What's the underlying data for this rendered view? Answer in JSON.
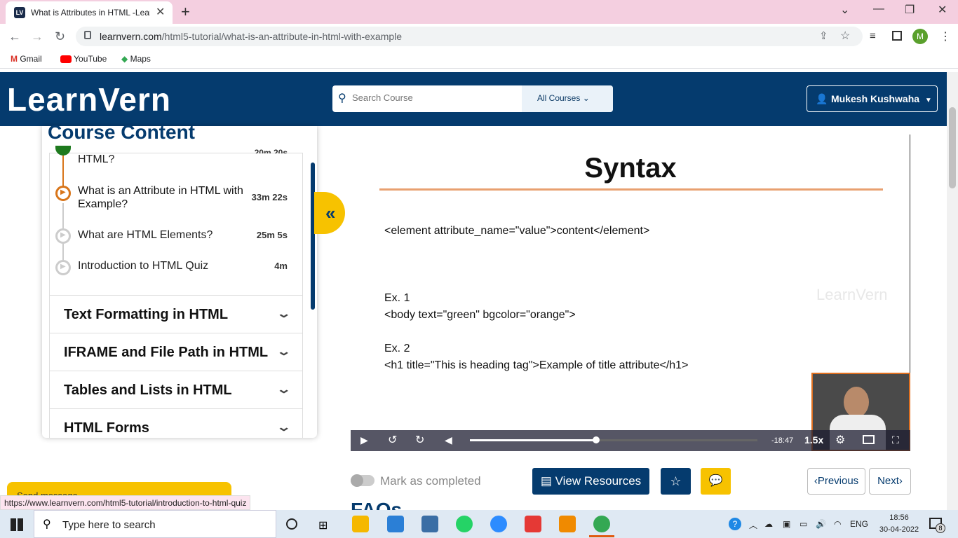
{
  "browser": {
    "tab_title": "What is Attributes in HTML -Lear",
    "url_domain": "learnvern.com",
    "url_path": "/html5-tutorial/what-is-an-attribute-in-html-with-example",
    "bookmarks": [
      "Gmail",
      "YouTube",
      "Maps"
    ],
    "profile_initial": "M"
  },
  "header": {
    "logo": "LearnVern",
    "search_placeholder": "Search Course",
    "category": "All Courses",
    "user": "Mukesh Kushwaha"
  },
  "course": {
    "title": "Course Content",
    "lessons": [
      {
        "title": "HTML?",
        "duration": "20m 20s"
      },
      {
        "title": "What is an Attribute in HTML with Example?",
        "duration": "33m 22s"
      },
      {
        "title": "What are HTML Elements?",
        "duration": "25m 5s"
      },
      {
        "title": "Introduction to HTML Quiz",
        "duration": "4m"
      }
    ],
    "sections": [
      "Text Formatting in HTML",
      "IFRAME and File Path in HTML",
      "Tables and Lists in HTML",
      "HTML Forms"
    ]
  },
  "slide": {
    "title": "Syntax",
    "syntax": "<element attribute_name=\"value\">content</element>",
    "ex1_label": "Ex. 1",
    "ex1_code": "<body text=\"green\" bgcolor=\"orange\">",
    "ex2_label": "Ex. 2",
    "ex2_code": "<h1 title=\"This is heading tag\">Example of title attribute</h1>",
    "watermark": "LearnVern"
  },
  "player": {
    "time_remaining": "-18:47",
    "speed": "1.5x",
    "progress": 0.44
  },
  "actions": {
    "mark_completed": "Mark as completed",
    "view_resources": "View Resources",
    "previous": "Previous",
    "next": "Next",
    "faqs": "FAQs",
    "send_message": "Send message"
  },
  "status_url": "https://www.learnvern.com/html5-tutorial/introduction-to-html-quiz",
  "taskbar": {
    "search_text": "Type here to search",
    "lang": "ENG",
    "time": "18:56",
    "date": "30-04-2022",
    "notifications": "8"
  },
  "colors": {
    "brand": "#053b6e",
    "accent": "#f7c200",
    "active_lesson": "#d8751a",
    "completed": "#1e7a1e"
  }
}
